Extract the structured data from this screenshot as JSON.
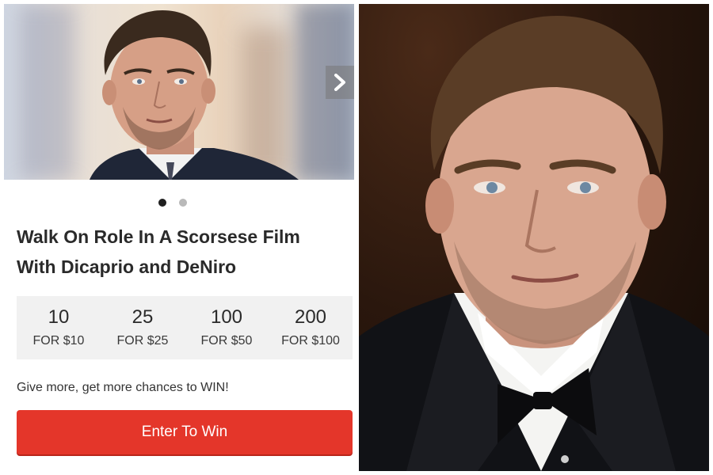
{
  "carousel": {
    "next_icon": "chevron-right-icon",
    "slides_count_dots": 2,
    "active_slide": 0
  },
  "listing": {
    "title_line1": "Walk On Role In A Scorsese Film",
    "title_line2": "With Dicaprio and DeNiro"
  },
  "tiers": [
    {
      "entries": "10",
      "price": "FOR $10"
    },
    {
      "entries": "25",
      "price": "FOR $25"
    },
    {
      "entries": "100",
      "price": "FOR $50"
    },
    {
      "entries": "200",
      "price": "FOR $100"
    }
  ],
  "prompt": "Give more, get more chances to WIN!",
  "cta": {
    "label": "Enter To Win"
  },
  "colors": {
    "accent": "#e4362a",
    "tier_bg": "#f1f1f1"
  }
}
